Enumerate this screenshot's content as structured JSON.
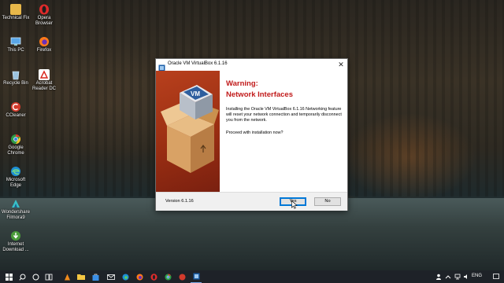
{
  "desktop": {
    "icons": [
      {
        "label": "Technical Fix",
        "icon": "folder-icon",
        "color": "#e8b84a"
      },
      {
        "label": "Opera Browser",
        "icon": "opera-icon",
        "color": "#e02b2b"
      },
      {
        "label": "This PC",
        "icon": "computer-icon",
        "color": "#5aa7e8"
      },
      {
        "label": "Firefox",
        "icon": "firefox-icon",
        "color": "#ff7a1a"
      },
      {
        "label": "Recycle Bin",
        "icon": "recycle-bin-icon",
        "color": "#9cc4e0"
      },
      {
        "label": "Acrobat Reader DC",
        "icon": "acrobat-icon",
        "color": "#d9261c"
      },
      {
        "label": "CCleaner",
        "icon": "ccleaner-icon",
        "color": "#d33a2c"
      },
      {
        "label": "Google Chrome",
        "icon": "chrome-icon",
        "color": "#2c9c4a"
      },
      {
        "label": "Microsoft Edge",
        "icon": "edge-icon",
        "color": "#1e8fd6"
      },
      {
        "label": "Wondershare Filmora9",
        "icon": "filmora-icon",
        "color": "#38c0c8"
      },
      {
        "label": "Internet Download ...",
        "icon": "idm-icon",
        "color": "#4a9a3a"
      }
    ]
  },
  "dialog": {
    "title": "Oracle VM VirtualBox 6.1.16",
    "close_glyph": "✕",
    "warning_line1": "Warning:",
    "warning_line2": "Network Interfaces",
    "message": "Installing the Oracle VM VirtualBox 6.1.16 Networking feature will reset your network connection and temporarily disconnect you from the network.",
    "question": "Proceed with installation now?",
    "version": "Version 6.1.16",
    "yes_label": "Yes",
    "no_label": "No",
    "banner_color": "#a8341a",
    "title_color": "#c11a1a"
  },
  "taskbar": {
    "items": [
      "windows-start-icon",
      "search-icon",
      "cortana-icon",
      "task-view-icon",
      "vlc-icon",
      "file-explorer-icon",
      "store-icon",
      "mail-icon",
      "edge-icon",
      "firefox-icon",
      "opera-icon",
      "chrome-icon",
      "virtualbox-icon"
    ],
    "language": "ENG",
    "tray_icons": [
      "people-icon",
      "chevron-up-icon",
      "network-icon",
      "volume-icon"
    ]
  }
}
